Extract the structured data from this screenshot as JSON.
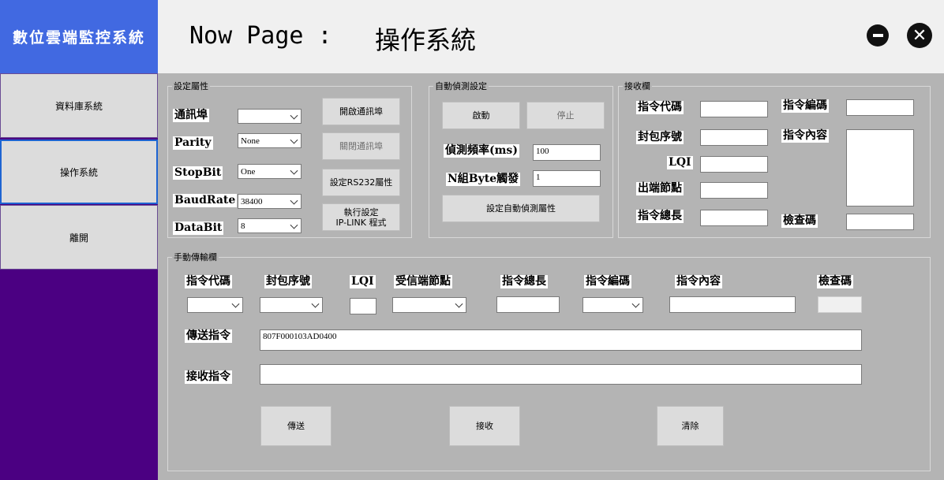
{
  "app": {
    "title": "數位雲端監控系統"
  },
  "sidebar": {
    "items": [
      {
        "label": "資料庫系統"
      },
      {
        "label": "操作系統"
      },
      {
        "label": "離開"
      }
    ]
  },
  "header": {
    "page_label": "Now Page :",
    "page_name": "操作系統",
    "minimize_glyph": "−",
    "close_glyph": "✕"
  },
  "settings": {
    "title": "設定屬性",
    "port_label": "通訊埠",
    "port_value": "",
    "parity_label": "Parity",
    "parity_value": "None",
    "stopbit_label": "StopBit",
    "stopbit_value": "One",
    "baudrate_label": "BaudRate",
    "baudrate_value": "38400",
    "databit_label": "DataBit",
    "databit_value": "8",
    "open_port_btn": "開啟通訊埠",
    "close_port_btn": "關閉通訊埠",
    "set_rs232_btn": "設定RS232屬性",
    "exec_btn_line1": "執行設定",
    "exec_btn_line2": "IP-LINK 程式"
  },
  "auto_detect": {
    "title": "自動偵測設定",
    "start_btn": "啟動",
    "stop_btn": "停止",
    "freq_label": "偵測頻率(ms)",
    "freq_value": "100",
    "nbyte_label": "N組Byte觸發",
    "nbyte_value": "1",
    "set_btn": "設定自動偵測屬性"
  },
  "receive": {
    "title": "接收欄",
    "cmd_code": "指令代碼",
    "cmd_code_value": "",
    "cmd_num": "指令編碼",
    "cmd_num_value": "",
    "packet_seq": "封包序號",
    "packet_seq_value": "",
    "cmd_content": "指令內容",
    "cmd_content_value": "",
    "lqi": "LQI",
    "lqi_value": "",
    "out_node": "出端節點",
    "out_node_value": "",
    "cmd_len": "指令總長",
    "cmd_len_value": "",
    "checksum": "檢查碼",
    "checksum_value": ""
  },
  "manual": {
    "title": "手動傳輸欄",
    "headers": {
      "cmd_code": "指令代碼",
      "packet_seq": "封包序號",
      "lqi": "LQI",
      "recv_node": "受信端節點",
      "cmd_len": "指令總長",
      "cmd_num": "指令編碼",
      "cmd_content": "指令內容",
      "checksum": "檢查碼"
    },
    "values": {
      "cmd_code": "",
      "packet_seq": "",
      "lqi": "",
      "recv_node": "",
      "cmd_len": "",
      "cmd_num": "",
      "cmd_content": "",
      "checksum": ""
    },
    "send_cmd_label": "傳送指令",
    "send_cmd_value": "807F000103AD0400",
    "recv_cmd_label": "接收指令",
    "recv_cmd_value": "",
    "send_btn": "傳送",
    "recv_btn": "接收",
    "clear_btn": "清除"
  },
  "colors": {
    "sidebar_bg": "#4b0082",
    "title_bar": "#4169e1",
    "main_bg": "#b4b4b4",
    "header_bg": "#f0f0f0",
    "active_border": "#1e64d2"
  }
}
